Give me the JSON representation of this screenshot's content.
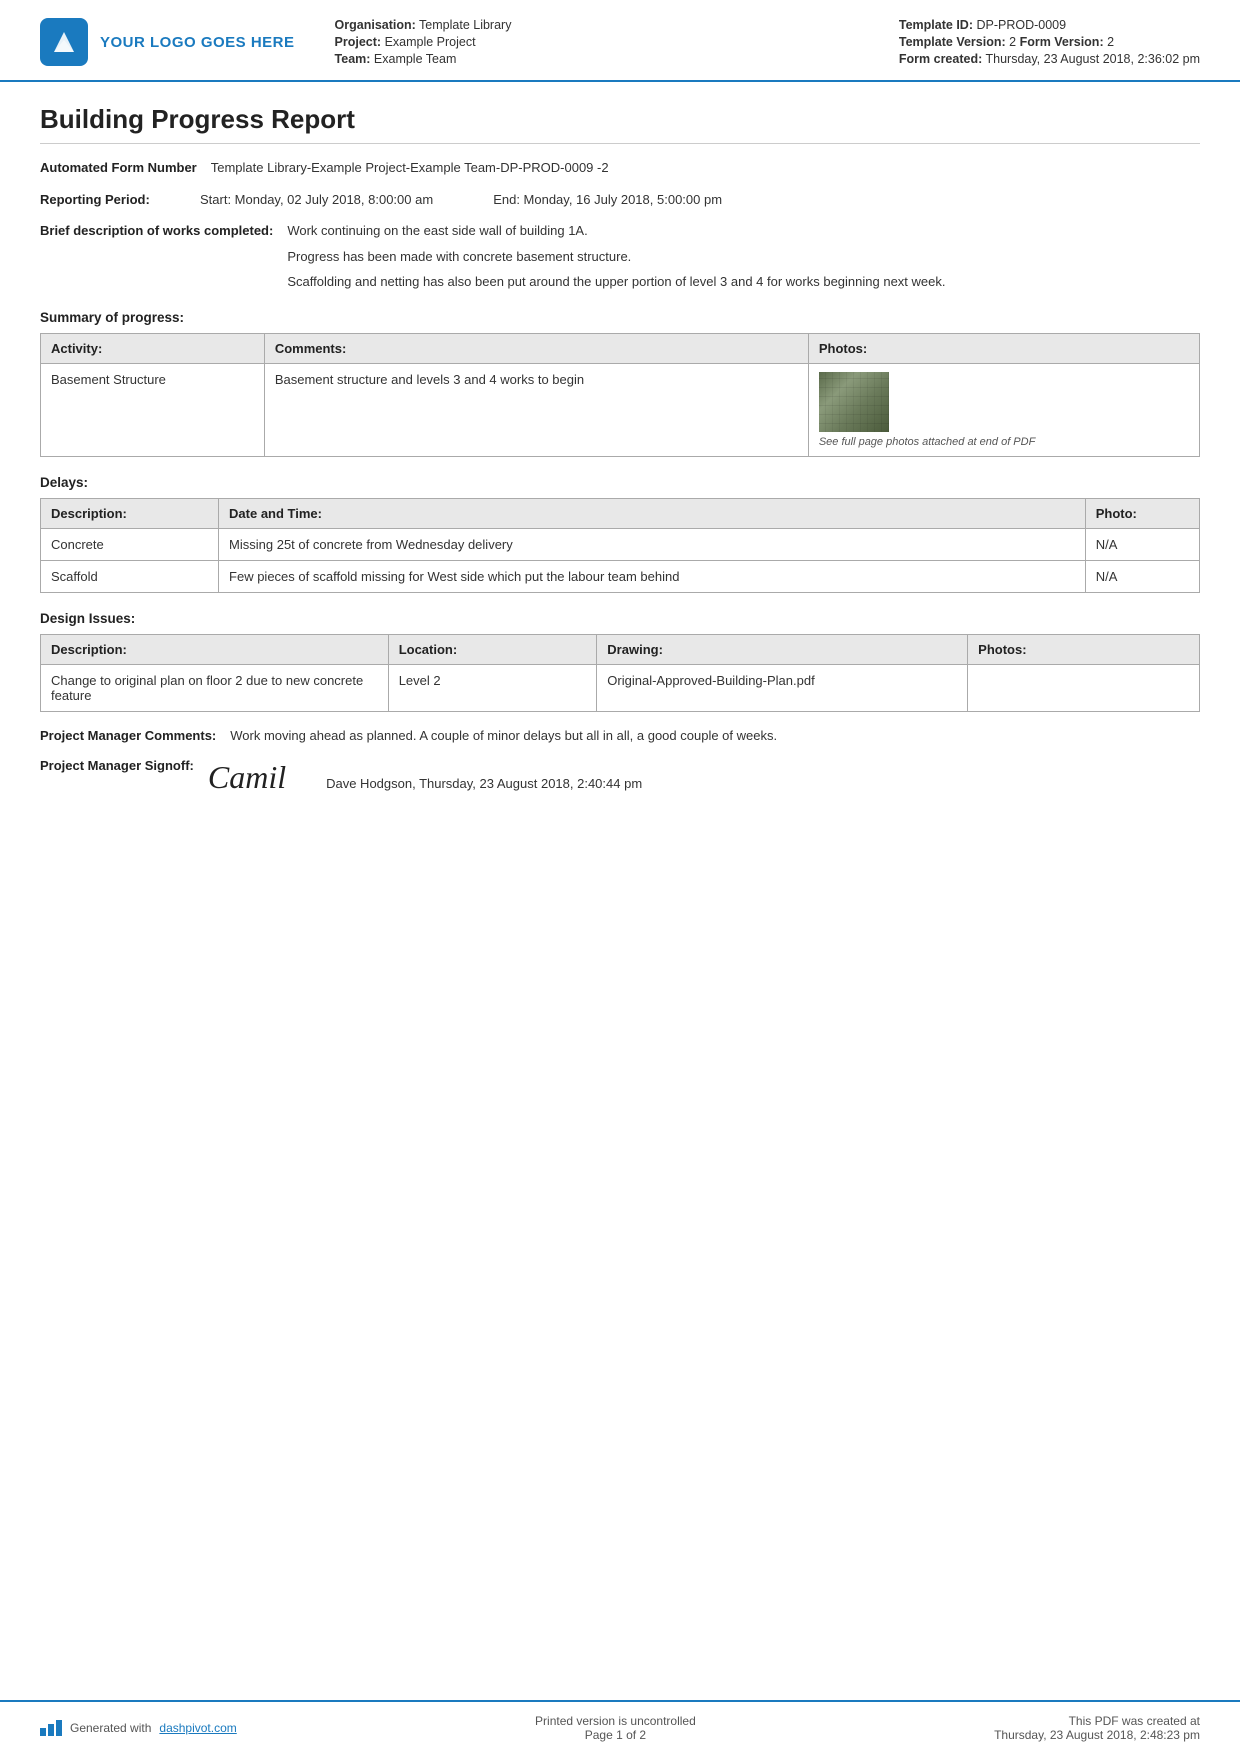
{
  "header": {
    "logo_text": "YOUR LOGO GOES HERE",
    "organisation_label": "Organisation:",
    "organisation_value": "Template Library",
    "project_label": "Project:",
    "project_value": "Example Project",
    "team_label": "Team:",
    "team_value": "Example Team",
    "template_id_label": "Template ID:",
    "template_id_value": "DP-PROD-0009",
    "template_version_label": "Template Version:",
    "template_version_value": "2",
    "form_version_label": "Form Version:",
    "form_version_value": "2",
    "form_created_label": "Form created:",
    "form_created_value": "Thursday, 23 August 2018, 2:36:02 pm"
  },
  "report": {
    "title": "Building Progress Report",
    "automated_form_number_label": "Automated Form Number",
    "automated_form_number_value": "Template Library-Example Project-Example Team-DP-PROD-0009   -2",
    "reporting_period_label": "Reporting Period:",
    "reporting_period_start": "Start: Monday, 02 July 2018, 8:00:00 am",
    "reporting_period_end": "End: Monday, 16 July 2018, 5:00:00 pm",
    "brief_description_label": "Brief description of works completed:",
    "brief_description_lines": [
      "Work continuing on the east side wall of building 1A.",
      "Progress has been made with concrete basement structure.",
      "Scaffolding and netting has also been put around the upper portion of level 3 and 4 for works beginning next week."
    ]
  },
  "summary_of_progress": {
    "section_title": "Summary of progress:",
    "table_headers": [
      "Activity:",
      "Comments:",
      "Photos:"
    ],
    "rows": [
      {
        "activity": "Basement Structure",
        "comments": "Basement structure and levels 3 and 4 works to begin",
        "has_photo": true,
        "photo_caption": "See full page photos attached at end of PDF"
      }
    ]
  },
  "delays": {
    "section_title": "Delays:",
    "table_headers": [
      "Description:",
      "Date and Time:",
      "Photo:"
    ],
    "rows": [
      {
        "description": "Concrete",
        "date_time": "Missing 25t of concrete from Wednesday delivery",
        "photo": "N/A"
      },
      {
        "description": "Scaffold",
        "date_time": "Few pieces of scaffold missing for West side which put the labour team behind",
        "photo": "N/A"
      }
    ]
  },
  "design_issues": {
    "section_title": "Design Issues:",
    "table_headers": [
      "Description:",
      "Location:",
      "Drawing:",
      "Photos:"
    ],
    "rows": [
      {
        "description": "Change to original plan on floor 2 due to new concrete feature",
        "location": "Level 2",
        "drawing": "Original-Approved-Building-Plan.pdf",
        "photos": ""
      }
    ]
  },
  "manager": {
    "comments_label": "Project Manager Comments:",
    "comments_value": "Work moving ahead as planned. A couple of minor delays but all in all, a good couple of weeks.",
    "signoff_label": "Project Manager Signoff:",
    "signature_text": "Camil",
    "signoff_name": "Dave Hodgson, Thursday, 23 August 2018, 2:40:44 pm"
  },
  "footer": {
    "generated_text": "Generated with",
    "generated_link": "dashpivot.com",
    "page_info": "Printed version is uncontrolled\nPage 1 of 2",
    "pdf_created_label": "This PDF was created at",
    "pdf_created_value": "Thursday, 23 August 2018, 2:48:23 pm"
  }
}
